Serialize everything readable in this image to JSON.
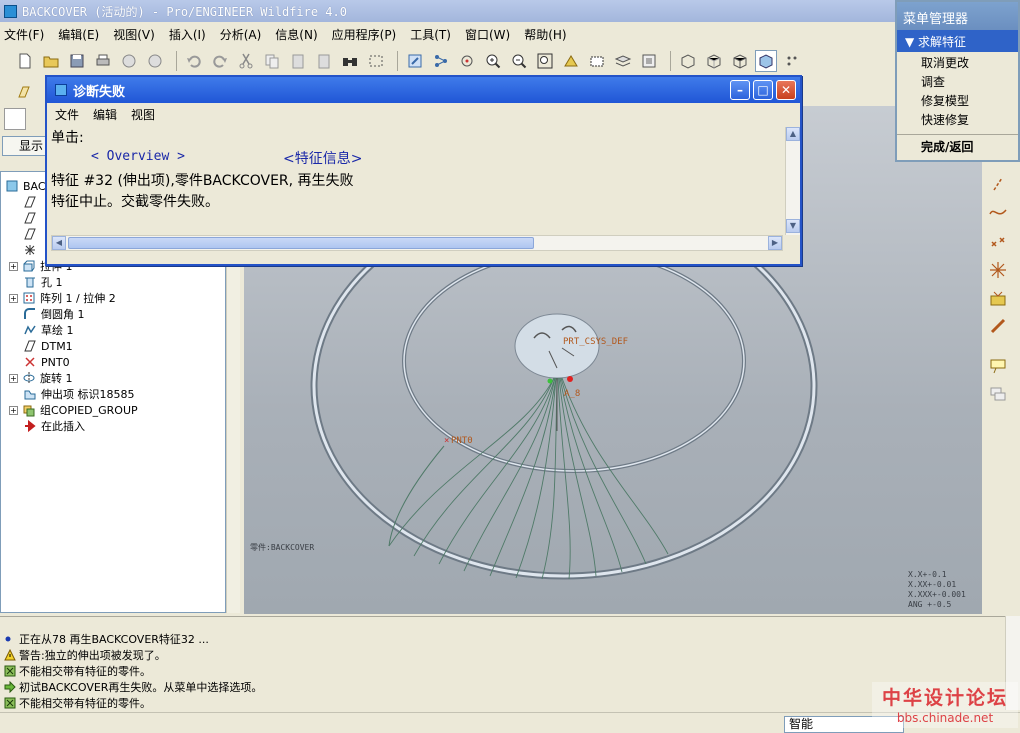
{
  "window": {
    "title": "BACKCOVER (活动的) - Pro/ENGINEER Wildfire 4.0"
  },
  "menubar": [
    "文件(F)",
    "编辑(E)",
    "视图(V)",
    "插入(I)",
    "分析(A)",
    "信息(N)",
    "应用程序(P)",
    "工具(T)",
    "窗口(W)",
    "帮助(H)"
  ],
  "navigator": {
    "show_button": "显示"
  },
  "model_tree": {
    "items": [
      {
        "label": "BACK",
        "icon": "part-icon",
        "expander": ""
      },
      {
        "label": "",
        "icon": "datum-plane-icon",
        "expander": ""
      },
      {
        "label": "",
        "icon": "datum-plane-icon",
        "expander": ""
      },
      {
        "label": "",
        "icon": "datum-plane-icon",
        "expander": ""
      },
      {
        "label": "",
        "icon": "csys-icon",
        "expander": ""
      },
      {
        "label": "拉伸 1",
        "icon": "extrude-icon",
        "expander": "+"
      },
      {
        "label": "孔 1",
        "icon": "hole-icon",
        "expander": ""
      },
      {
        "label": "阵列 1 / 拉伸 2",
        "icon": "pattern-icon",
        "expander": "+"
      },
      {
        "label": "倒圆角 1",
        "icon": "round-icon",
        "expander": ""
      },
      {
        "label": "草绘 1",
        "icon": "sketch-icon",
        "expander": ""
      },
      {
        "label": "DTM1",
        "icon": "datum-plane-icon",
        "expander": ""
      },
      {
        "label": "PNT0",
        "icon": "datum-point-icon",
        "expander": ""
      },
      {
        "label": "旋转 1",
        "icon": "revolve-icon",
        "expander": "+"
      },
      {
        "label": "伸出项 标识18585",
        "icon": "protrusion-icon",
        "expander": ""
      },
      {
        "label": "组COPIED_GROUP",
        "icon": "group-icon",
        "expander": "+"
      },
      {
        "label": "在此插入",
        "icon": "insert-here-arrow-icon",
        "expander": ""
      }
    ]
  },
  "menu_manager": {
    "title": "菜单管理器",
    "active_menu": "求解特征",
    "items": [
      "取消更改",
      "调查",
      "修复模型",
      "快速修复"
    ],
    "done": "完成/返回"
  },
  "diagnostic_dialog": {
    "title": "诊断失败",
    "menu": [
      "文件",
      "编辑",
      "视图"
    ],
    "click_prompt": "单击:",
    "link_overview": "< Overview >",
    "link_feature_info": "<特征信息>",
    "line1": "特征 #32 (伸出项),零件BACKCOVER, 再生失败",
    "line2": "特征中止。交截零件失败。"
  },
  "graphics": {
    "model_label": "零件:BACKCOVER",
    "datum_labels": [
      "PRT_CSYS_DEF",
      "A_8",
      "PNT0"
    ],
    "tolerance": [
      "X.X+-0.1",
      "X.XX+-0.01",
      "X.XXX+-0.001",
      "ANG +-0.5"
    ]
  },
  "messages": [
    {
      "icon": "info-dot-icon",
      "text": "正在从78 再生BACKCOVER特征32 ..."
    },
    {
      "icon": "warning-icon",
      "text": "警告:独立的伸出项被发现了。"
    },
    {
      "icon": "error-icon",
      "text": "不能相交带有特征的零件。"
    },
    {
      "icon": "arrow-right-icon",
      "text": "初试BACKCOVER再生失败。从菜单中选择选项。"
    },
    {
      "icon": "error-icon",
      "text": "不能相交带有特征的零件。"
    }
  ],
  "statusbar": {
    "filter": "智能"
  },
  "watermark": {
    "line1": "中华设计论坛",
    "line2": "bbs.chinade.net"
  },
  "colors": {
    "selection_blue": "#2f63c8",
    "dialog_title": "#2056d6",
    "viewport": "#b4bac1"
  }
}
